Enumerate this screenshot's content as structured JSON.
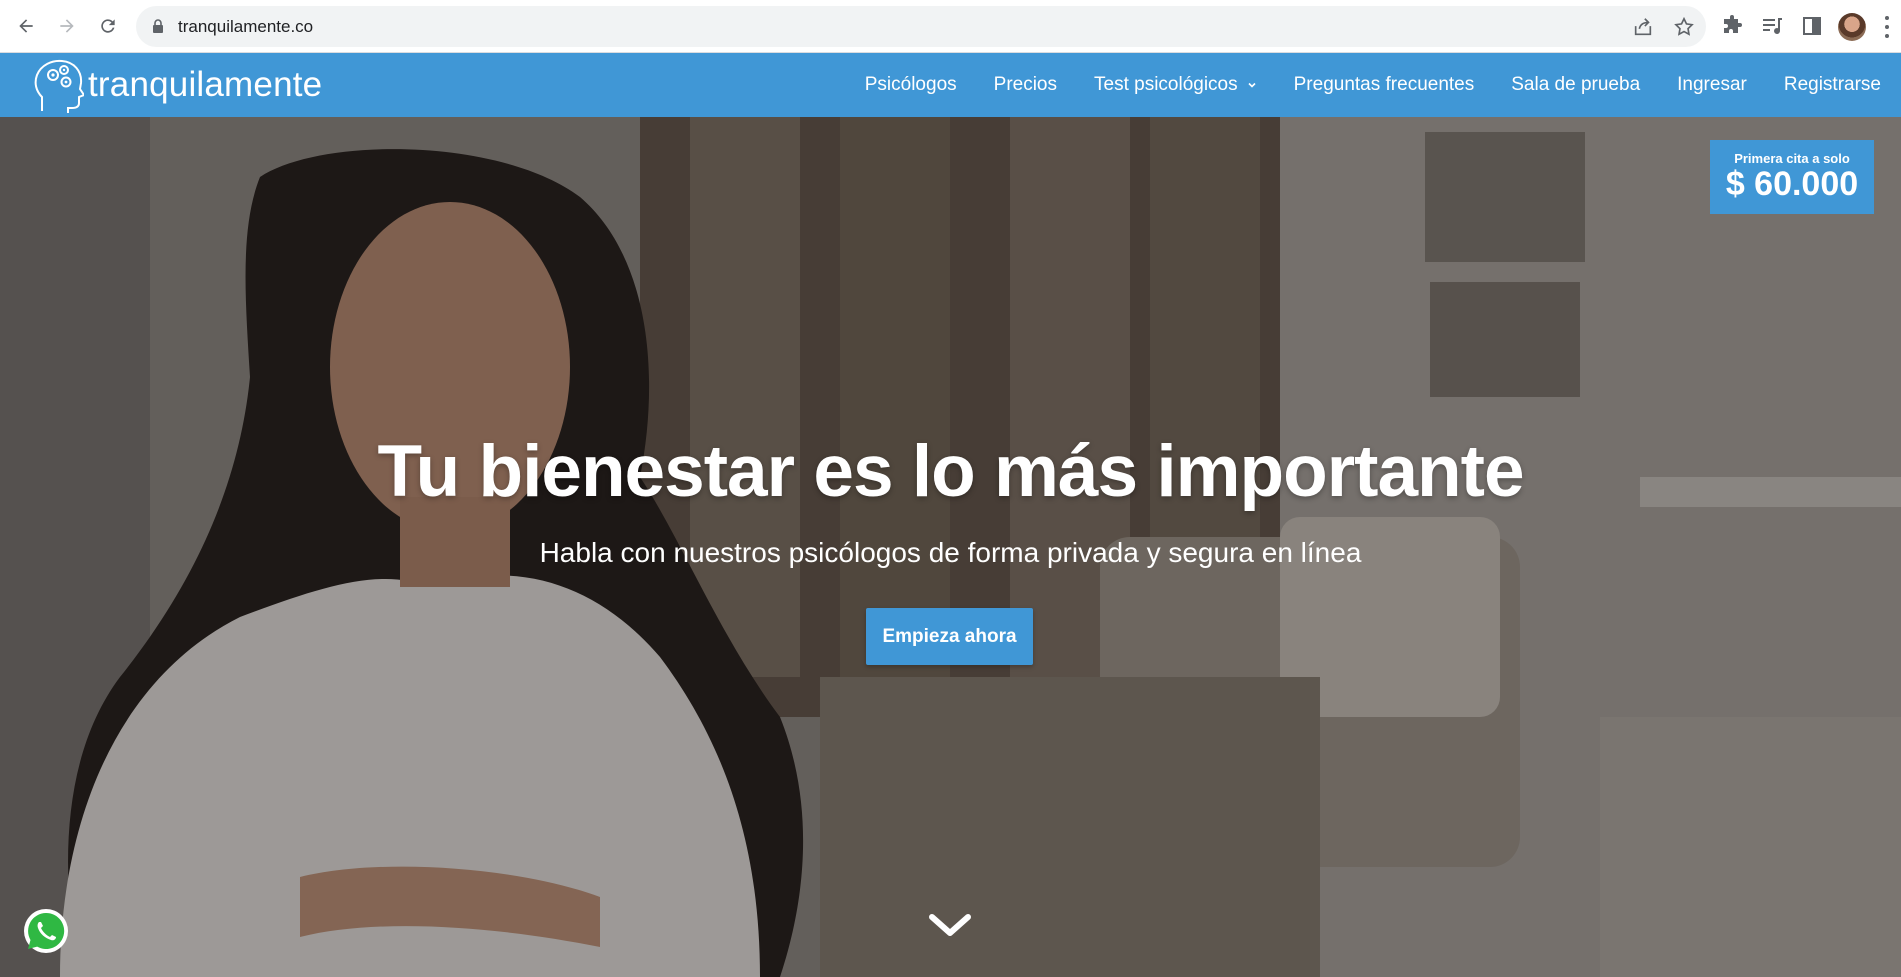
{
  "browser": {
    "url": "tranquilamente.co"
  },
  "site": {
    "logo_text": "tranquilamente",
    "menu": [
      {
        "label": "Psicólogos"
      },
      {
        "label": "Precios"
      },
      {
        "label": "Test psicológicos",
        "has_dropdown": true
      },
      {
        "label": "Preguntas frecuentes"
      },
      {
        "label": "Sala de prueba"
      },
      {
        "label": "Ingresar"
      },
      {
        "label": "Registrarse"
      }
    ],
    "brand_color": "#4097d6"
  },
  "hero": {
    "promo_label": "Primera cita a solo",
    "promo_price": "$ 60.000",
    "headline": "Tu bienestar es lo más importante",
    "subheadline": "Habla con nuestros psicólogos de forma privada y segura en línea",
    "cta_label": "Empieza ahora"
  },
  "icons": [
    "back-arrow-icon",
    "forward-arrow-icon",
    "reload-icon",
    "lock-icon",
    "share-icon",
    "star-icon",
    "puzzle-icon",
    "media-icon",
    "side-panel-icon",
    "chevron-down-icon",
    "whatsapp-icon"
  ]
}
